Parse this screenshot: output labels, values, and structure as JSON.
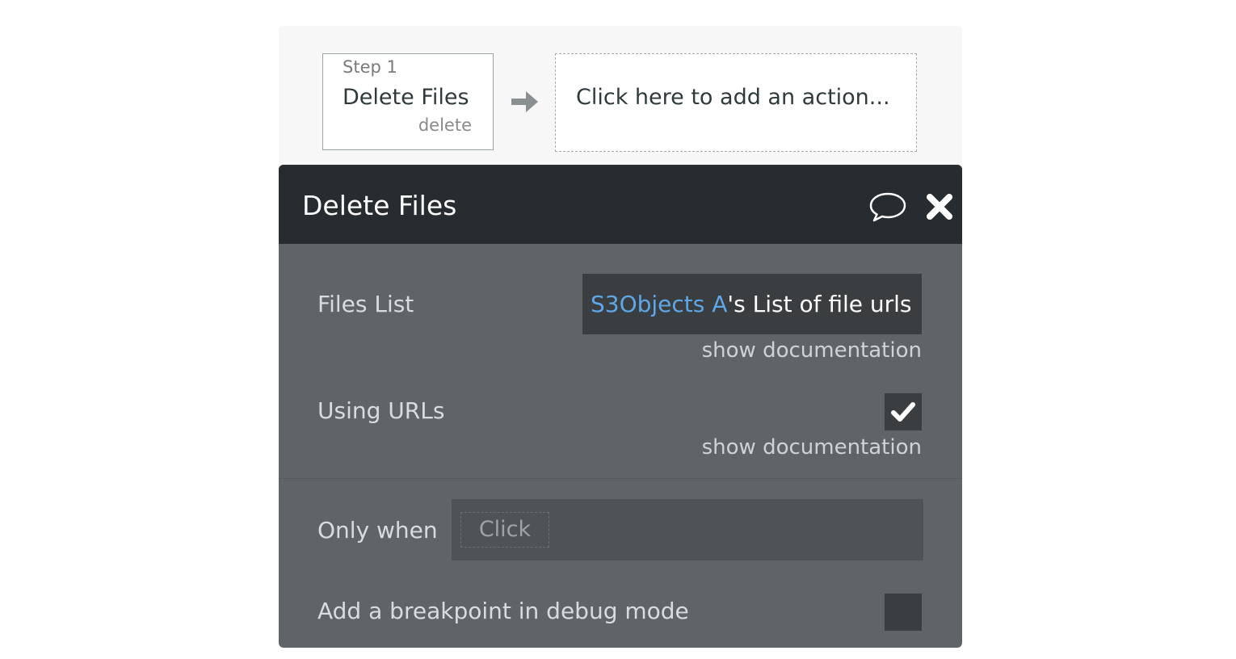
{
  "workflow": {
    "step": {
      "number_label": "Step 1",
      "title": "Delete Files",
      "subtitle": "delete"
    },
    "arrow_icon": "arrow-right-icon",
    "add_action_label": "Click here to add an action..."
  },
  "panel": {
    "title": "Delete Files",
    "comment_icon": "comment-icon",
    "close_icon": "close-icon",
    "fields": {
      "files_list": {
        "label": "Files List",
        "value_source": "S3Objects A",
        "value_rest": "'s List of file urls",
        "doc_link": "show documentation"
      },
      "using_urls": {
        "label": "Using URLs",
        "checked": true,
        "doc_link": "show documentation"
      }
    },
    "only_when": {
      "label": "Only when",
      "placeholder": "Click"
    },
    "breakpoint": {
      "label": "Add a breakpoint in debug mode",
      "checked": false
    }
  },
  "colors": {
    "header_bg": "#262c2f",
    "panel_bg": "#5e6468",
    "dynamic_source": "#5ea8e9",
    "input_bg": "#3b3e40"
  }
}
